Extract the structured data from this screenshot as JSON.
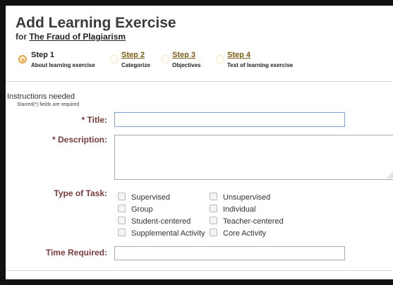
{
  "header": {
    "title": "Add Learning Exercise",
    "for_prefix": "for",
    "for_link": "The Fraud of Plagiarism"
  },
  "steps": [
    {
      "label": "Step 1",
      "desc": "About learning exercise",
      "active": true
    },
    {
      "label": "Step 2",
      "desc": "Categorize",
      "active": false
    },
    {
      "label": "Step 3",
      "desc": "Objectives",
      "active": false
    },
    {
      "label": "Step 4",
      "desc": "Text of learning exercise",
      "active": false
    }
  ],
  "form": {
    "instructions": "Instructions needed",
    "starred_note": "Starred(*) fields are required",
    "title_label": "* Title:",
    "title_value": "",
    "description_label": "* Description:",
    "description_value": "",
    "type_label": "Type of Task:",
    "task_types": [
      "Supervised",
      "Unsupervised",
      "Group",
      "Individual",
      "Student-centered",
      "Teacher-centered",
      "Supplemental Activity",
      "Core Activity"
    ],
    "time_label": "Time Required:",
    "time_value": ""
  },
  "colors": {
    "accent": "#e8a33c",
    "label": "#7a3a3a",
    "link": "#7a5a14"
  }
}
